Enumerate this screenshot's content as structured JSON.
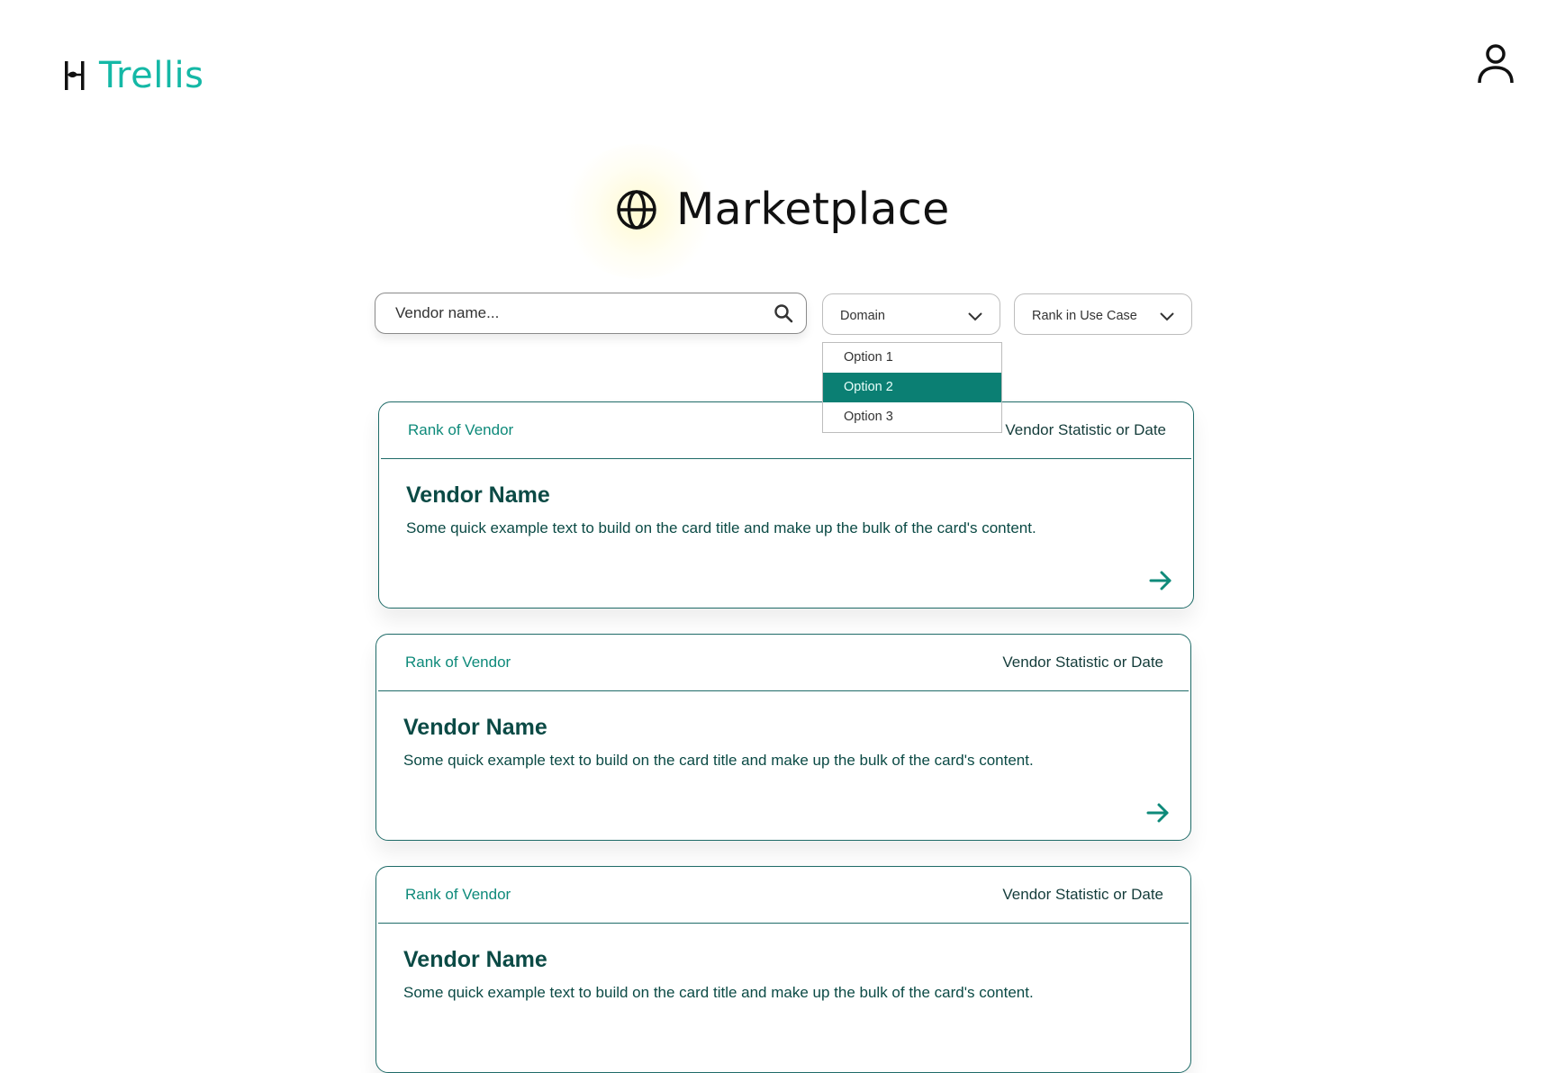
{
  "header": {
    "brand_name": "Trellis"
  },
  "hero": {
    "title": "Marketplace"
  },
  "search": {
    "placeholder": "Vendor name..."
  },
  "filters": {
    "domain_label": "Domain",
    "rank_label": "Rank in Use Case",
    "domain_options": [
      "Option 1",
      "Option 2",
      "Option 3"
    ],
    "domain_selected_index": 1
  },
  "cards": [
    {
      "rank": "Rank of Vendor",
      "stat": "Vendor Statistic or Date",
      "name": "Vendor Name",
      "description": "Some quick example text to build on the card title and make up the bulk of the card's content."
    },
    {
      "rank": "Rank of Vendor",
      "stat": "Vendor Statistic or Date",
      "name": "Vendor Name",
      "description": "Some quick example text to build on the card title and make up the bulk of the card's content."
    },
    {
      "rank": "Rank of Vendor",
      "stat": "Vendor Statistic or Date",
      "name": "Vendor Name",
      "description": "Some quick example text to build on the card title and make up the bulk of the card's content."
    }
  ],
  "colors": {
    "brand": "#14b8a6",
    "accent": "#0b7f73",
    "card_border": "#1f6b68",
    "card_text": "#0b4a45"
  },
  "icons": {
    "logo": "trellis-logo-icon",
    "user": "user-icon",
    "globe": "globe-icon",
    "search": "search-icon",
    "chevron": "chevron-down-icon",
    "arrow": "arrow-right-icon"
  }
}
